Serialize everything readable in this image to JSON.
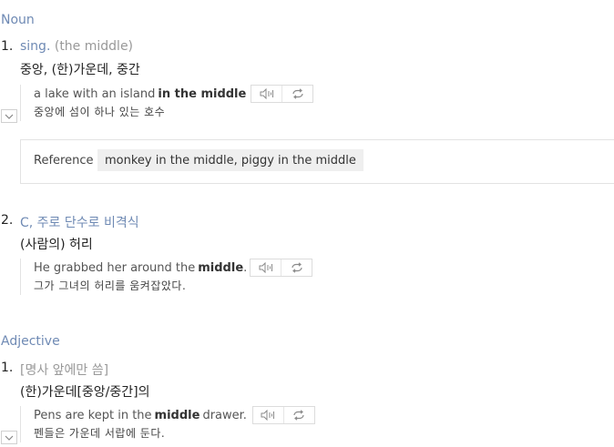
{
  "noun": {
    "pos_label": "Noun",
    "senses": [
      {
        "number": "1.",
        "grammar": "sing.",
        "grammar_note": "(the middle)",
        "meaning": "중앙, (한)가운데, 중간",
        "example": {
          "before": "a lake with an island",
          "highlight": "in the middle",
          "after": "",
          "translation": "중앙에 섬이 하나 있는 호수"
        },
        "reference": {
          "label": "Reference",
          "value": "monkey in the middle, piggy in the middle"
        }
      },
      {
        "number": "2.",
        "grammar": "C, 주로 단수로 비격식",
        "meaning": "(사람의) 허리",
        "example": {
          "before": "He grabbed her around the",
          "highlight": "middle",
          "after": ".",
          "translation": "그가 그녀의 허리를 움켜잡았다."
        }
      }
    ]
  },
  "adjective": {
    "pos_label": "Adjective",
    "senses": [
      {
        "number": "1.",
        "grammar": "[명사 앞에만 씀]",
        "meaning": "(한)가운데[중앙/중간]의",
        "example": {
          "before": "Pens are kept in the",
          "highlight": "middle",
          "after": "drawer.",
          "translation": "펜들은 가운데 서랍에 둔다."
        }
      }
    ]
  },
  "icons": {
    "listen": "speaker-icon",
    "repeat": "repeat-icon",
    "expand": "chevron-down-icon"
  },
  "colors": {
    "pos": "#6f8ab4",
    "grammar_muted": "#999999",
    "text": "#222222"
  }
}
